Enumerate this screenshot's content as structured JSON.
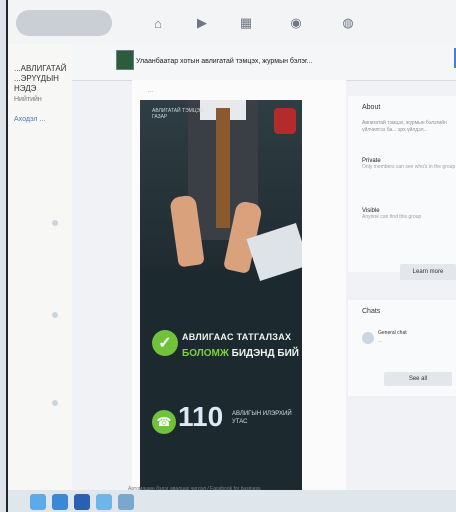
{
  "topbar": {
    "nav_icons": [
      "home-icon",
      "video-icon",
      "marketplace-icon",
      "groups-icon",
      "gaming-icon"
    ]
  },
  "sidebar": {
    "title": "...АВЛИГАТАЙ ...ЭРҮҮДЫН НЭДЭ",
    "sub": "Нийтийн",
    "link": "Аходэл ..."
  },
  "group": {
    "name": "Улаанбаатар хотын авлигатай тэмцэх, журмын бэлэг..."
  },
  "post": {
    "author": "...",
    "poster": {
      "top_small": "АВЛИГАТАЙ ТЭМЦЭХ ГАЗАР",
      "line1": "АВЛИГААС ТАТГАЛЗАХ",
      "line2a": "БОЛОМЖ",
      "line2b": " БИДЭНД БИЙ",
      "hotline_number": "110",
      "hotline_label": "АВЛИГЫН ИЛЭРХИЙ УТАС"
    },
    "caption": "Автомашин бэлэг авалцах чиглэл / Facebook for business"
  },
  "about": {
    "title": "About",
    "description": "Авлигатай тэмцэх, журмын бэлэгийн үйлчилгээ ба... эрх үйлдэл...",
    "private_title": "Private",
    "private_sub": "Only members can see who's in the group",
    "visible_title": "Visible",
    "visible_sub": "Anyone can find this group",
    "learn_more": "Learn more"
  },
  "chats": {
    "title": "Chats",
    "item_name": "General chat",
    "item_msg": "...",
    "see_all": "See all"
  },
  "taskbar": {
    "icons": [
      "start-icon",
      "file-explorer-icon",
      "browser-icon",
      "mail-icon",
      "app-icon"
    ]
  },
  "colors": {
    "accent_blue": "#3c82d6",
    "poster_green": "#6fc23a",
    "poster_dark": "#1c2a2f"
  }
}
